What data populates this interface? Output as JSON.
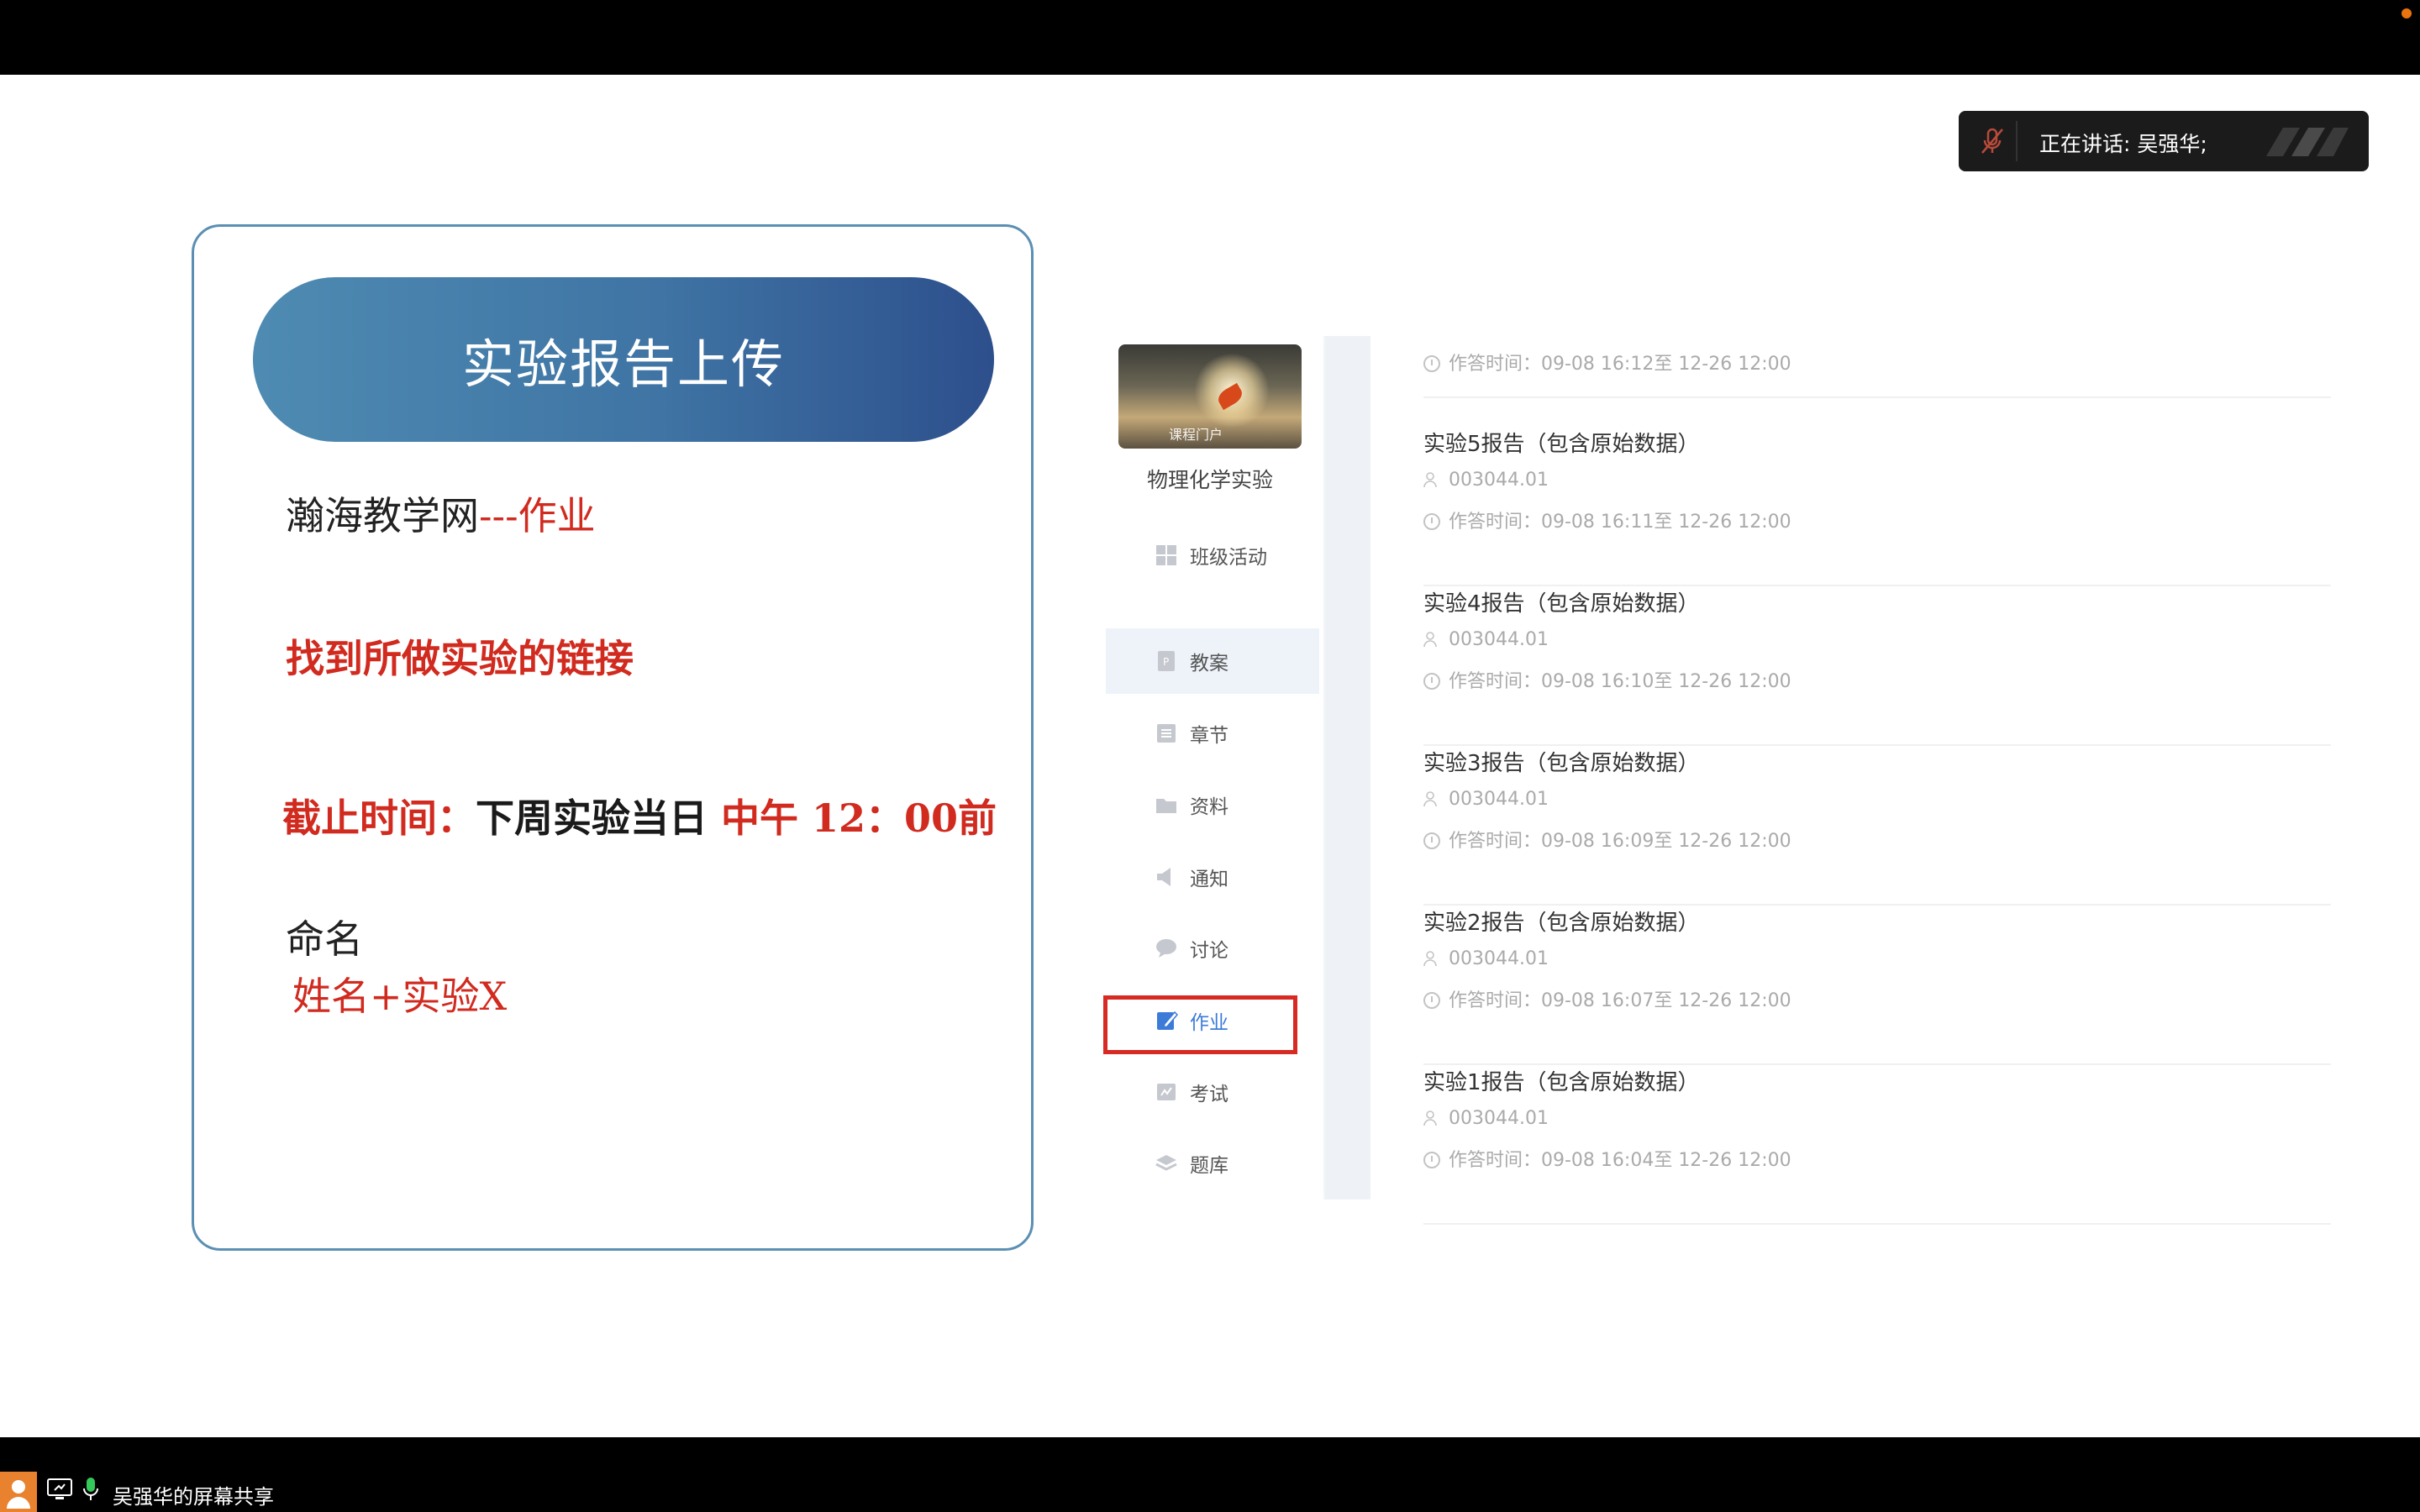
{
  "speaking_indicator": {
    "label": "正在讲话: 吴强华;"
  },
  "slide": {
    "title": "实验报告上传",
    "line1": {
      "text": "瀚海教学网",
      "sep": "---",
      "red": "作业"
    },
    "line2": "找到所做实验的链接",
    "line3": {
      "label": "截止时间：",
      "mid": "下周实验当日 ",
      "noon": "中午 ",
      "time": "12：00前"
    },
    "line4": "命名",
    "line5": "姓名+实验X"
  },
  "course": {
    "image_tag": "课程门户",
    "name": "物理化学实验",
    "class_activity": "班级活动",
    "nav": [
      {
        "label": "教案",
        "icon": "doc-icon"
      },
      {
        "label": "章节",
        "icon": "list-icon"
      },
      {
        "label": "资料",
        "icon": "folder-icon"
      },
      {
        "label": "通知",
        "icon": "speaker-icon"
      },
      {
        "label": "讨论",
        "icon": "chat-icon"
      },
      {
        "label": "作业",
        "icon": "edit-icon"
      },
      {
        "label": "考试",
        "icon": "exam-icon"
      },
      {
        "label": "题库",
        "icon": "stack-icon"
      }
    ]
  },
  "assignments": {
    "first_time": "作答时间：09-08 16:12至 12-26 12:00",
    "items": [
      {
        "name": "实验5报告（包含原始数据）",
        "code": "003044.01",
        "time": "作答时间：09-08 16:11至 12-26 12:00"
      },
      {
        "name": "实验4报告（包含原始数据）",
        "code": "003044.01",
        "time": "作答时间：09-08 16:10至 12-26 12:00"
      },
      {
        "name": "实验3报告（包含原始数据）",
        "code": "003044.01",
        "time": "作答时间：09-08 16:09至 12-26 12:00"
      },
      {
        "name": "实验2报告（包含原始数据）",
        "code": "003044.01",
        "time": "作答时间：09-08 16:07至 12-26 12:00"
      },
      {
        "name": "实验1报告（包含原始数据）",
        "code": "003044.01",
        "time": "作答时间：09-08 16:04至 12-26 12:00"
      }
    ]
  },
  "bottom_bar": {
    "label": "吴强华的屏幕共享"
  },
  "colors": {
    "accent_red": "#d12a1f",
    "title_blue": "#3f74a4",
    "active_blue": "#3d7bd9"
  }
}
